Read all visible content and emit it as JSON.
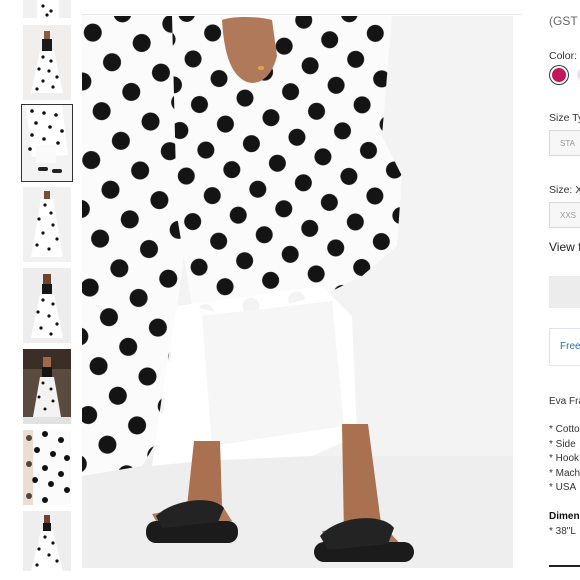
{
  "thumbnails": [
    {
      "name": "thumb-1"
    },
    {
      "name": "thumb-2"
    },
    {
      "name": "thumb-3",
      "selected": true
    },
    {
      "name": "thumb-4"
    },
    {
      "name": "thumb-5"
    },
    {
      "name": "thumb-6"
    },
    {
      "name": "thumb-7"
    },
    {
      "name": "thumb-8"
    }
  ],
  "product": {
    "price_note": "(GST i",
    "color_label": "Color:",
    "size_type_label": "Size Ty",
    "size_type_option": "STA",
    "size_label": "Size: X",
    "size_option": "XXS",
    "view_link": "View f",
    "shipping_text": "Free",
    "brand_text": "Eva Fra",
    "bullets": [
      "* Cotto",
      "* Side",
      "* Hook",
      "* Mach",
      "* USA"
    ],
    "dimensions_label": "Dimen",
    "dimensions_value": "* 38\"L"
  },
  "colors": {
    "swatch_1": "#c2185b",
    "swatch_2": "#e8e3ee",
    "dot": "#141414",
    "fabric": "#fbfbfb"
  }
}
